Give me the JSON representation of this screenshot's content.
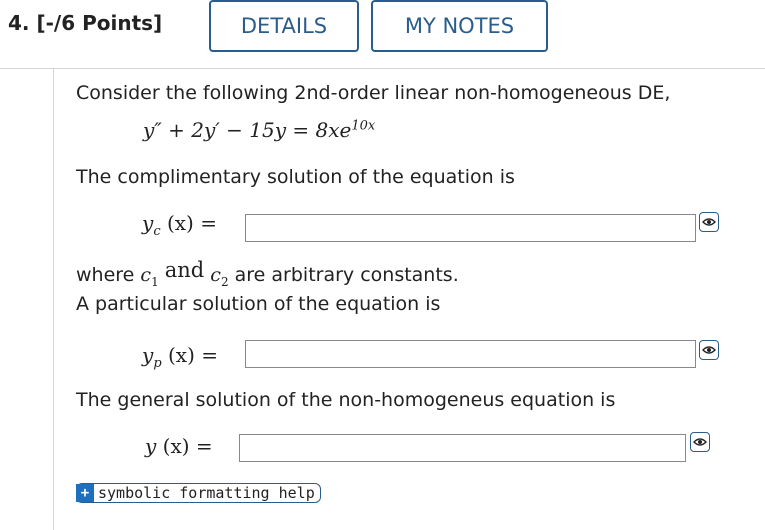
{
  "header": {
    "question_label": "4. [-/6 Points]",
    "details_label": "DETAILS",
    "notes_label": "MY NOTES"
  },
  "problem": {
    "intro": "Consider the following 2nd-order linear non-homogeneous DE,",
    "de_lhs": "y″ + 2y′ − 15y = 8xe",
    "de_exp": "10x",
    "comp_prompt": "The complimentary solution of the equation is",
    "yc_label": "y",
    "yc_sub": "c",
    "yc_arg": "(x) =",
    "where_text": "where",
    "c1": "c",
    "c1_sub": "1",
    "and_text": "and",
    "c2": "c",
    "c2_sub": "2",
    "arbitrary_text": "are arbitrary constants.",
    "part_prompt": "A particular solution of the equation is",
    "yp_label": "y",
    "yp_sub": "p",
    "yp_arg": "(x) =",
    "gen_prompt": "The general solution of the non-homogeneus equation is",
    "y_label": "y",
    "y_arg": "(x) ="
  },
  "answers": {
    "yc_value": "",
    "yp_value": "",
    "y_value": ""
  },
  "icons": {
    "eye": "eye-preview-icon",
    "help": "plus-minus-symbol-icon"
  },
  "help": {
    "icon_glyph": "+",
    "label": "symbolic formatting help"
  },
  "colors": {
    "accent": "#2a5d8c",
    "help_icon_bg": "#1f6fbf"
  }
}
